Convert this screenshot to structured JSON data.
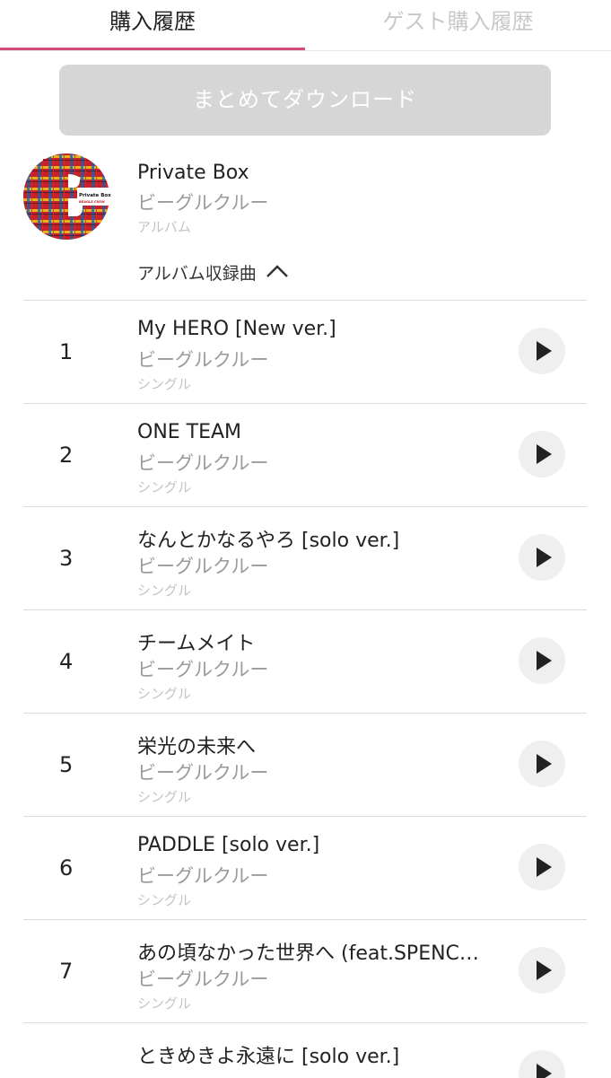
{
  "tabs": {
    "purchase_history": "購入履歴",
    "guest_purchase_history": "ゲスト購入履歴"
  },
  "download_all_label": "まとめてダウンロード",
  "album": {
    "title": "Private Box",
    "artist": "ビーグルクルー",
    "type": "アルバム",
    "art_text_1": "Private Box",
    "art_text_2": "BEAGLE CREW",
    "tracklist_label": "アルバム収録曲"
  },
  "tracks": [
    {
      "number": "1",
      "title": "My HERO [New ver.]",
      "artist": "ビーグルクルー",
      "type": "シングル"
    },
    {
      "number": "2",
      "title": "ONE TEAM",
      "artist": "ビーグルクルー",
      "type": "シングル"
    },
    {
      "number": "3",
      "title": "なんとかなるやろ [solo ver.]",
      "artist": "ビーグルクルー",
      "type": "シングル"
    },
    {
      "number": "4",
      "title": "チームメイト",
      "artist": "ビーグルクルー",
      "type": "シングル"
    },
    {
      "number": "5",
      "title": "栄光の未来へ",
      "artist": "ビーグルクルー",
      "type": "シングル"
    },
    {
      "number": "6",
      "title": "PADDLE [solo ver.]",
      "artist": "ビーグルクルー",
      "type": "シングル"
    },
    {
      "number": "7",
      "title": "あの頃なかった世界へ (feat.SPENC…",
      "artist": "ビーグルクルー",
      "type": "シングル"
    },
    {
      "number": "",
      "title": "ときめきよ永遠に [solo ver.]",
      "artist": "",
      "type": ""
    }
  ],
  "colors": {
    "accent": "#d24b7a",
    "disabled_button": "#d6d6d6",
    "play_button_bg": "#efefef"
  }
}
